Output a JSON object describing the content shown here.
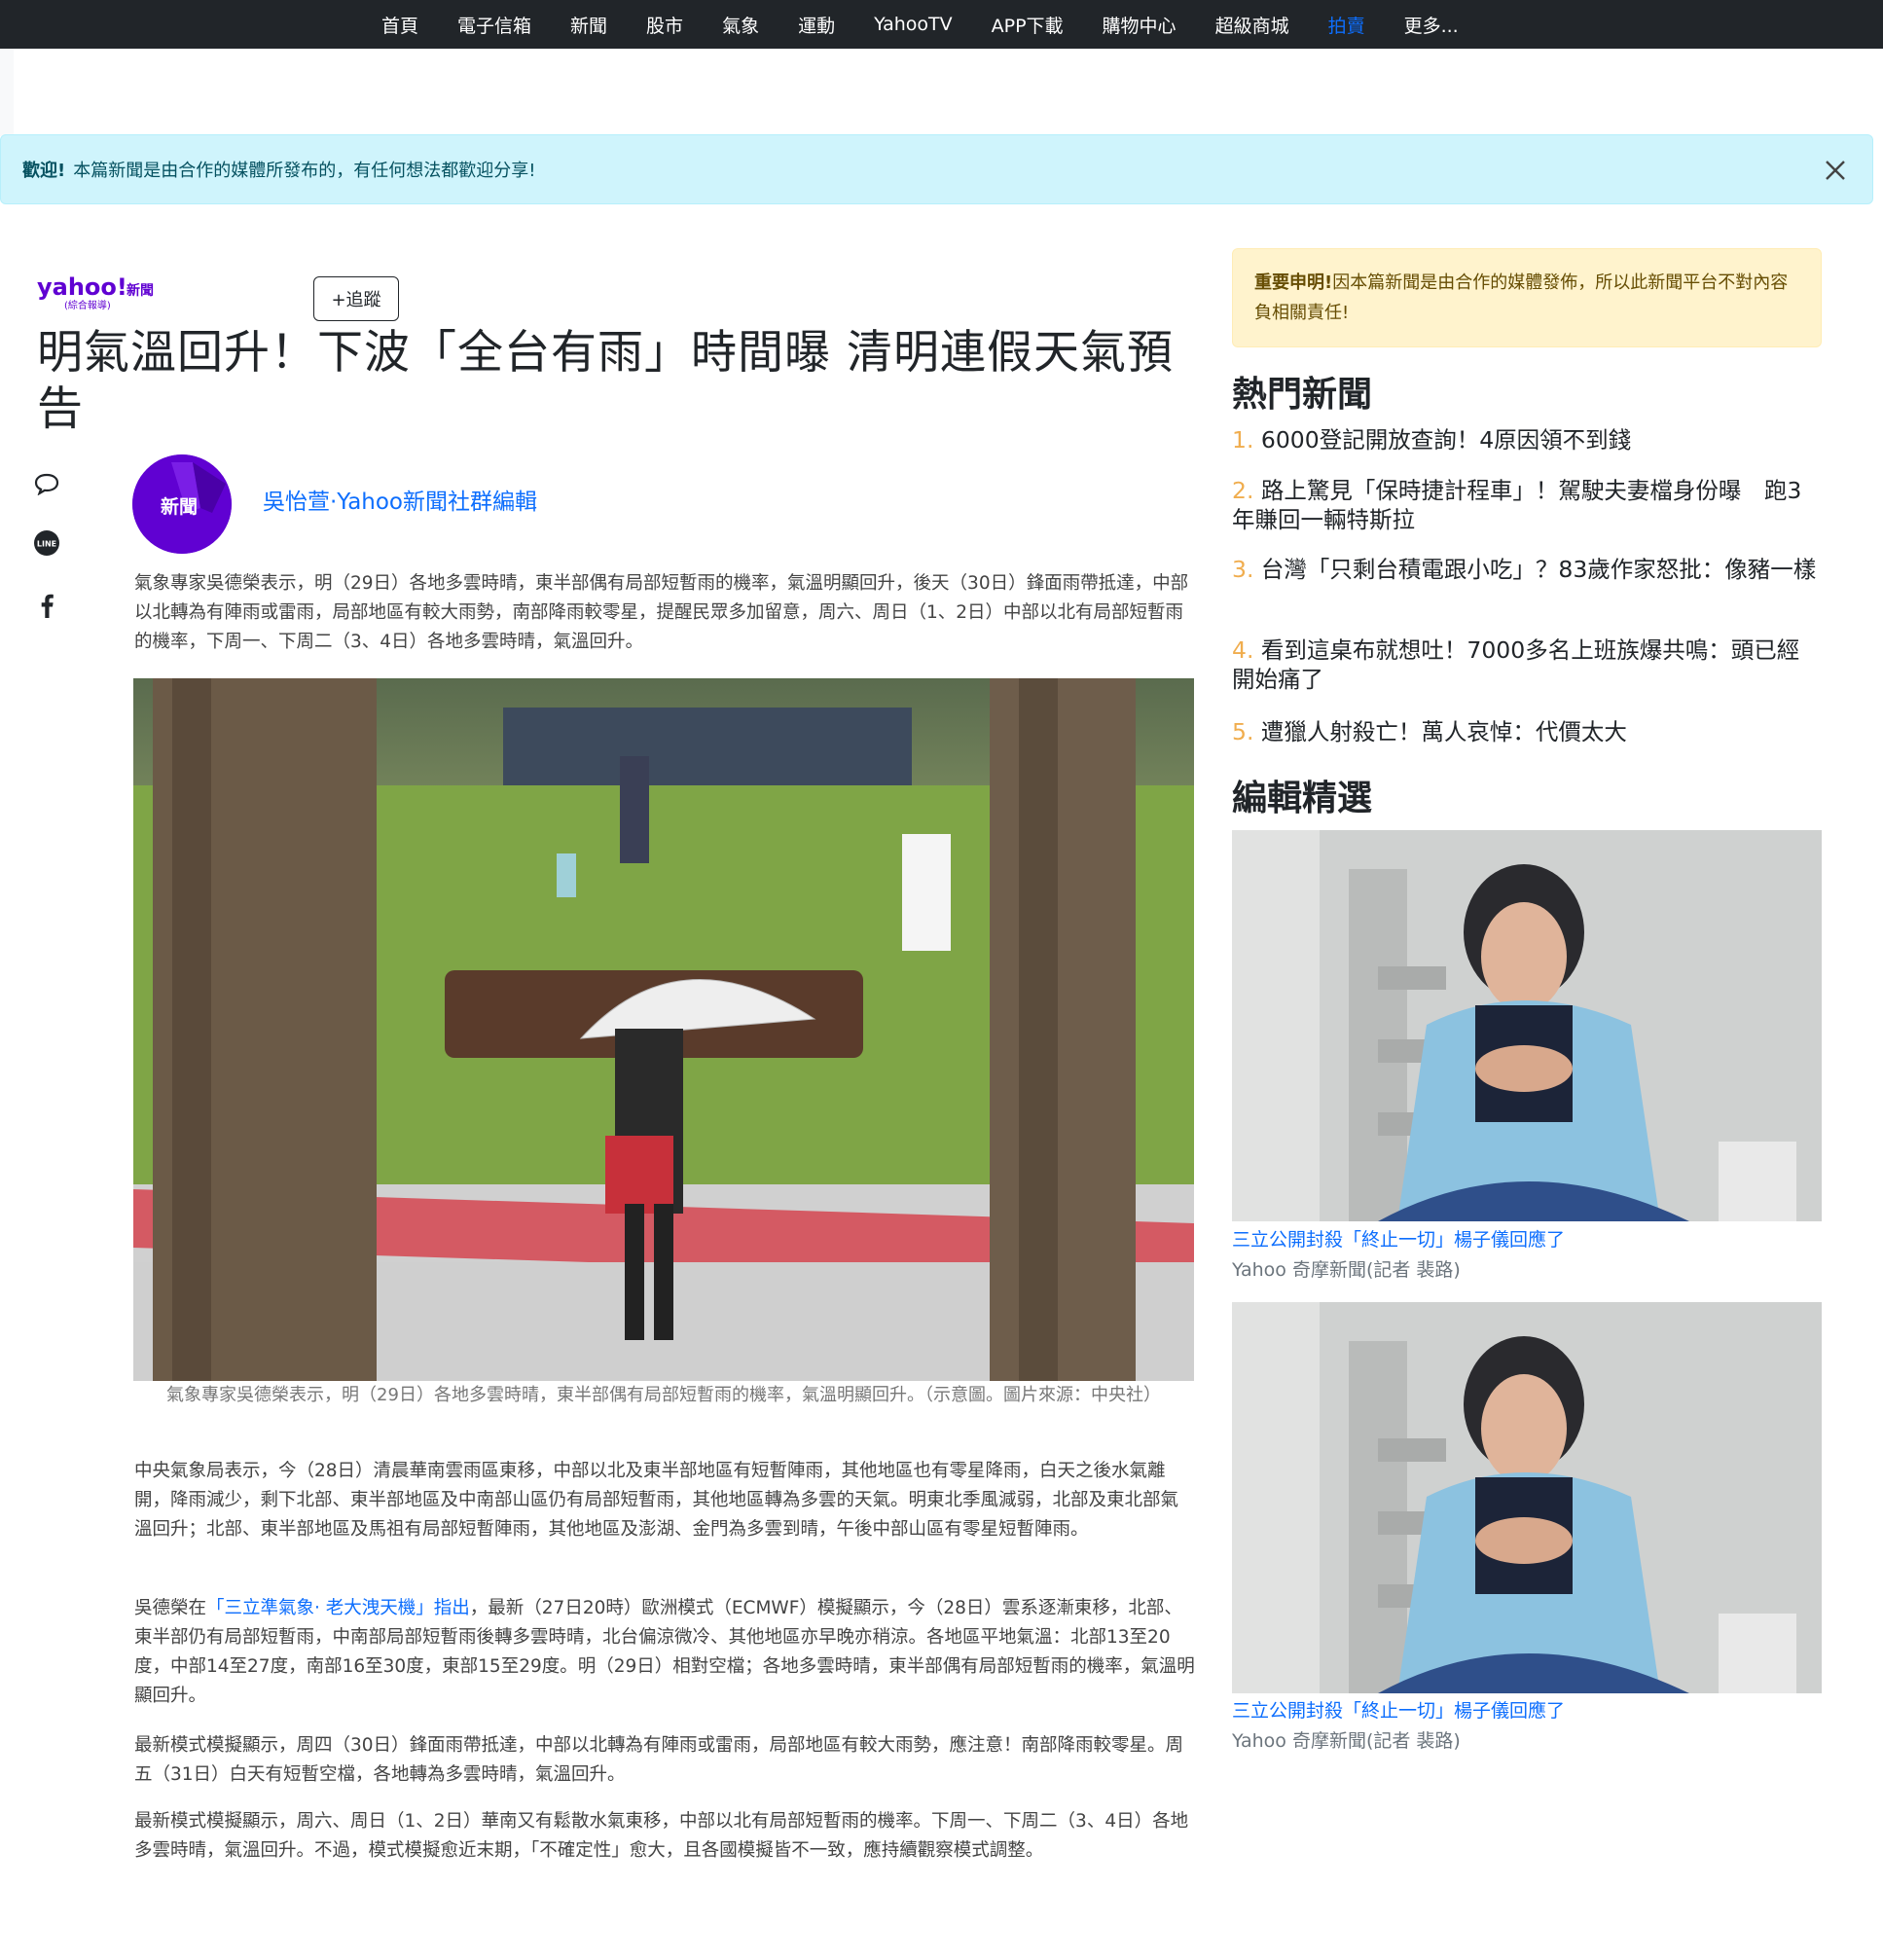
{
  "nav": {
    "items": [
      "首頁",
      "電子信箱",
      "新聞",
      "股市",
      "氣象",
      "運動",
      "YahooTV",
      "APP下載",
      "購物中心",
      "超級商城",
      "拍賣",
      "更多..."
    ],
    "active_index": 10
  },
  "alert": {
    "strong": "歡迎!",
    "text": "本篇新聞是由合作的媒體所發布的，有任何想法都歡迎分享!"
  },
  "article": {
    "brand_logo_text": "yahoo!",
    "brand_sub": "新聞",
    "brand_tag": "(綜合報導)",
    "follow_label": "+追蹤",
    "title": "明氣溫回升！下波「全台有雨」時間曝 清明連假天氣預告",
    "avatar_text": "新聞",
    "author": "吳怡萱·Yahoo新聞社群編輯",
    "para1": "氣象專家吳德榮表示，明（29日）各地多雲時晴，東半部偶有局部短暫雨的機率，氣溫明顯回升，後天（30日）鋒面雨帶抵達，中部以北轉為有陣雨或雷雨，局部地區有較大雨勢，南部降雨較零星，提醒民眾多加留意，周六、周日（1、2日）中部以北有局部短暫雨的機率，下周一、下周二（3、4日）各地多雲時晴，氣溫回升。",
    "caption": "氣象專家吳德榮表示，明（29日）各地多雲時晴，東半部偶有局部短暫雨的機率，氣溫明顯回升。（示意圖。圖片來源：中央社）",
    "para2": "中央氣象局表示，今（28日）清晨華南雲雨區東移，中部以北及東半部地區有短暫陣雨，其他地區也有零星降雨，白天之後水氣離開，降雨減少，剩下北部、東半部地區及中南部山區仍有局部短暫雨，其他地區轉為多雲的天氣。明東北季風減弱，北部及東北部氣溫回升；北部、東半部地區及馬祖有局部短暫陣雨，其他地區及澎湖、金門為多雲到晴，午後中部山區有零星短暫陣雨。",
    "para3_before": "吳德榮在",
    "para3_link": "「三立準氣象· 老大洩天機」指出",
    "para3_after": "，最新（27日20時）歐洲模式（ECMWF）模擬顯示，今（28日）雲系逐漸東移，北部、東半部仍有局部短暫雨，中南部局部短暫雨後轉多雲時晴，北台偏涼微冷、其他地區亦早晚亦稍涼。各地區平地氣溫：北部13至20度，中部14至27度，南部16至30度，東部15至29度。明（29日）相對空檔；各地多雲時晴，東半部偶有局部短暫雨的機率，氣溫明顯回升。",
    "para4": "最新模式模擬顯示，周四（30日）鋒面雨帶抵達，中部以北轉為有陣雨或雷雨，局部地區有較大雨勢，應注意！南部降雨較零星。周五（31日）白天有短暫空檔，各地轉為多雲時晴，氣溫回升。",
    "para5": "最新模式模擬顯示，周六、周日（1、2日）華南又有鬆散水氣東移，中部以北有局部短暫雨的機率。下周一、下周二（3、4日）各地多雲時晴，氣溫回升。不過，模式模擬愈近末期，「不確定性」愈大，且各國模擬皆不一致，應持續觀察模式調整。"
  },
  "sidebar": {
    "notice_strong": "重要申明!",
    "notice_text": "因本篇新聞是由合作的媒體發佈，所以此新聞平台不對內容負相關責任!",
    "hot_heading": "熱門新聞",
    "hot": [
      {
        "num": "1.",
        "title": "6000登記開放查詢！4原因領不到錢"
      },
      {
        "num": "2.",
        "title": "路上驚見「保時捷計程車」！駕駛夫妻檔身份曝　跑3年賺回一輛特斯拉"
      },
      {
        "num": "3.",
        "title": "台灣「只剩台積電跟小吃」？83歲作家怒批：像豬一樣"
      },
      {
        "num": "4.",
        "title": "看到這桌布就想吐！7000多名上班族爆共鳴：頭已經開始痛了"
      },
      {
        "num": "5.",
        "title": "遭獵人射殺亡！萬人哀悼：代價太大"
      }
    ],
    "picks_heading": "編輯精選",
    "picks": [
      {
        "title": "三立公開封殺「終止一切」楊子儀回應了",
        "source": "Yahoo 奇摩新聞(記者 裴路)"
      },
      {
        "title": "三立公開封殺「終止一切」楊子儀回應了",
        "source": "Yahoo 奇摩新聞(記者 裴路)"
      }
    ]
  },
  "colors": {
    "nav_bg": "#212529",
    "link": "#0d6efd",
    "alert_bg": "#cff4fc",
    "notice_bg": "#fff3cd",
    "yahoo_purple": "#6001d2",
    "hot_number": "#f0ad4e"
  },
  "icons": [
    "close-icon",
    "comment-icon",
    "line-icon",
    "facebook-icon"
  ]
}
